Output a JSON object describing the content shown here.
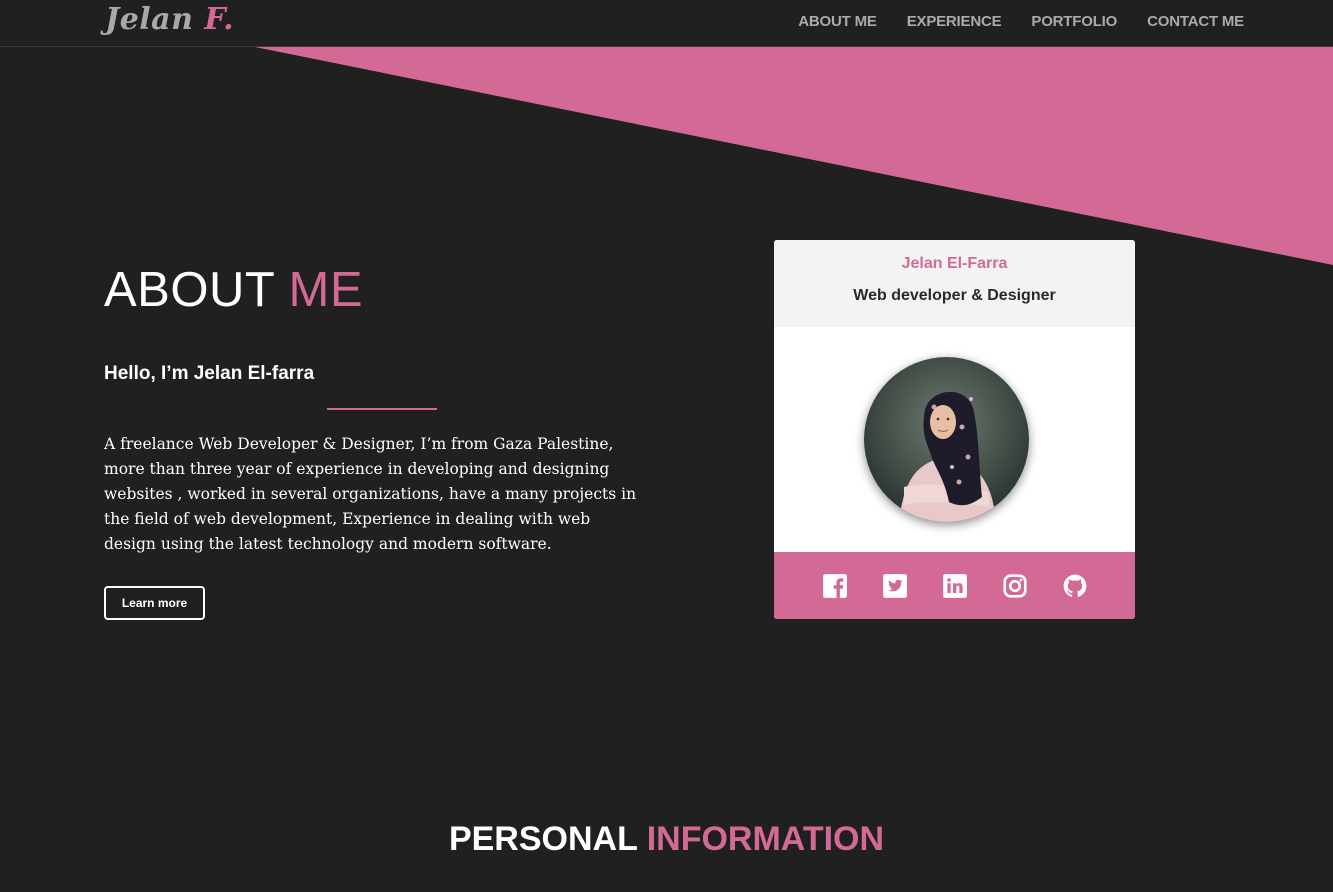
{
  "colors": {
    "background": "#202020",
    "accent": "#d36a95",
    "card_head": "#f3f3f3"
  },
  "logo": {
    "first": "Jelan ",
    "accent": "F."
  },
  "nav": [
    {
      "label": "ABOUT ME"
    },
    {
      "label": "EXPERIENCE"
    },
    {
      "label": "PORTFOLIO"
    },
    {
      "label": "CONTACT ME"
    }
  ],
  "about": {
    "title_white": "ABOUT ",
    "title_pink": "ME",
    "greeting": "Hello, I’m Jelan El-farra",
    "intro": "A freelance Web Developer & Designer, I’m from Gaza Palestine, more than three year of experience in developing and designing websites , worked in several organizations, have a many projects in the field of web development, Experience in dealing with web design using the latest technology and modern software.",
    "button_label": "Learn more"
  },
  "card": {
    "name": "Jelan El-Farra",
    "role": "Web developer & Designer",
    "social_icons": [
      "facebook-icon",
      "twitter-icon",
      "linkedin-icon",
      "instagram-icon",
      "github-icon"
    ]
  },
  "personal": {
    "title_white": "PERSONAL ",
    "title_pink": "INFORMATION"
  }
}
